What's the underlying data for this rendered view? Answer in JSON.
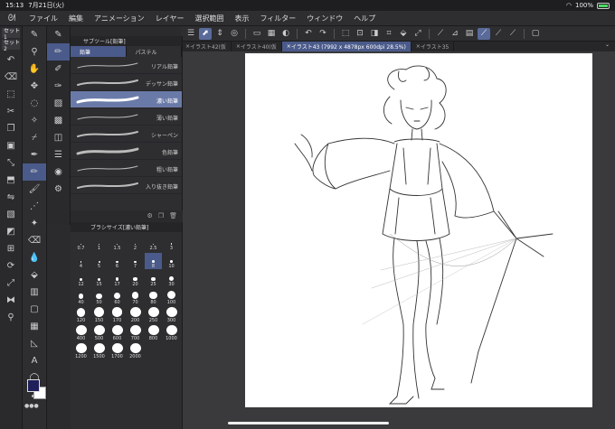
{
  "status": {
    "time": "15:13",
    "date": "7月21日(火)",
    "battery": "100%"
  },
  "menu": {
    "items": [
      "ファイル",
      "編集",
      "アニメーション",
      "レイヤー",
      "選択範囲",
      "表示",
      "フィルター",
      "ウィンドウ",
      "ヘルプ"
    ]
  },
  "tabs": [
    {
      "label": "イラスト42(仮"
    },
    {
      "label": "イラスト40(仮"
    },
    {
      "label": "イラスト43 (7992 x 4878px 600dpi 28.5%)"
    },
    {
      "label": "イラスト35"
    }
  ],
  "left": {
    "set1": "セット1",
    "set2": "セット2"
  },
  "subtool": {
    "header": "サブツール[鉛筆]",
    "tab_pencil": "鉛筆",
    "tab_pastel": "パステル",
    "brushes": [
      "リアル鉛筆",
      "デッサン鉛筆",
      "濃い鉛筆",
      "薄い鉛筆",
      "シャーペン",
      "色鉛筆",
      "粗い鉛筆",
      "入り抜き鉛筆"
    ]
  },
  "brushsize": {
    "header": "ブラシサイズ[濃い鉛筆]",
    "sizes": [
      "0.7",
      "1",
      "1.5",
      "2",
      "2.5",
      "3",
      "4",
      "5",
      "6",
      "7",
      "8",
      "10",
      "12",
      "15",
      "17",
      "20",
      "25",
      "30",
      "40",
      "50",
      "60",
      "70",
      "80",
      "100",
      "120",
      "150",
      "170",
      "200",
      "250",
      "300",
      "400",
      "500",
      "600",
      "700",
      "800",
      "1000",
      "1200",
      "1500",
      "1700",
      "2000"
    ],
    "selected": "8"
  },
  "colors": {
    "main": "#1f1f5a",
    "sub": "#ffffff",
    "accent": "#4a5a8a"
  }
}
